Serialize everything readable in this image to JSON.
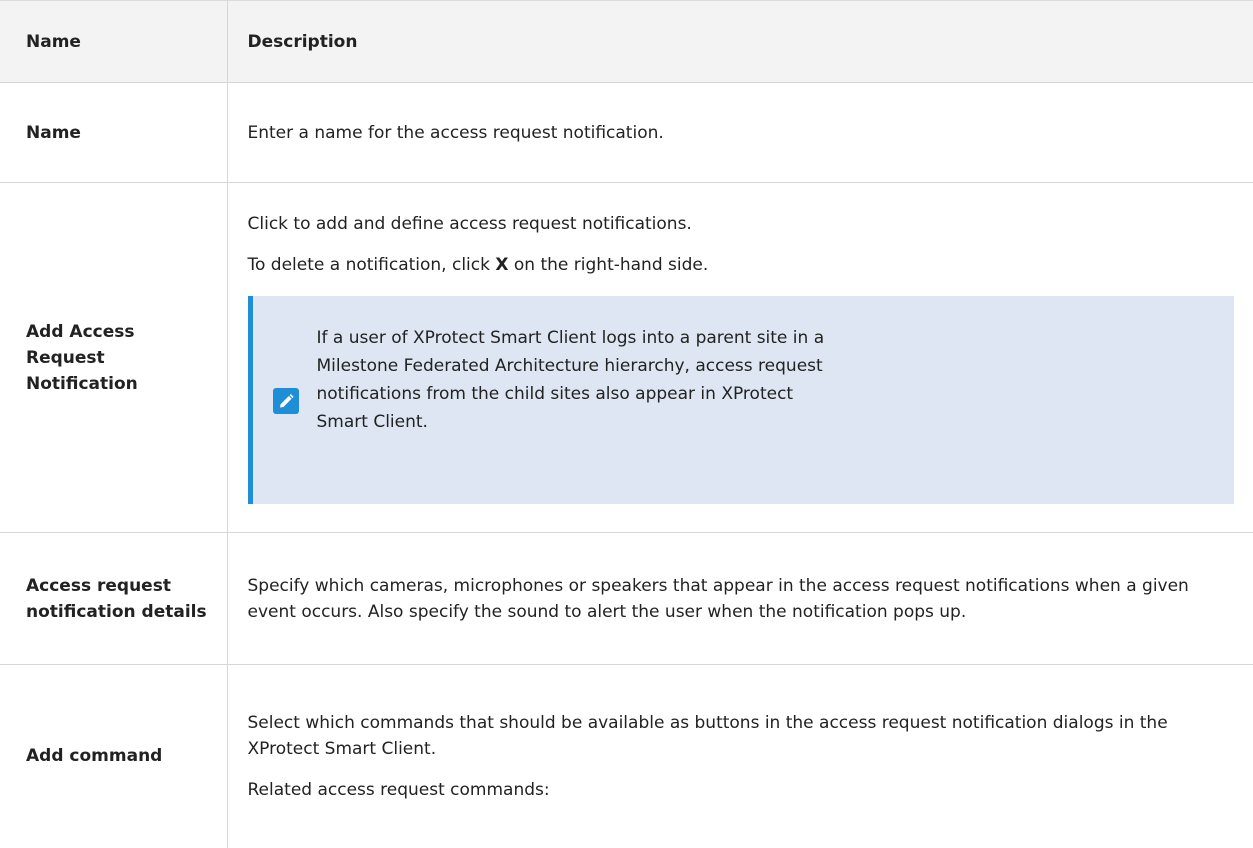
{
  "table": {
    "header": {
      "name": "Name",
      "description": "Description"
    },
    "rows": [
      {
        "name": "Name",
        "description": "Enter a name for the access request notification."
      },
      {
        "name": "Add Access Request Notification",
        "para1": "Click to add and define access request notifications.",
        "para2_before": "To delete a notification, click ",
        "para2_key": "X",
        "para2_after": " on the right-hand side.",
        "note": {
          "icon": "pencil-icon",
          "accent_color": "#1e8fd6",
          "background_color": "#dde6f2",
          "text": "If a user of XProtect Smart Client logs into a parent site in a Milestone Federated Architecture hierarchy, access request notifications from the child sites also appear in XProtect Smart Client."
        }
      },
      {
        "name": "Access request notification details",
        "description": "Specify which cameras, microphones or speakers that appear in the access request notifications when a given event occurs. Also specify the sound to alert the user when the notification pops up."
      },
      {
        "name": "Add command",
        "para1": "Select which commands that should be available as buttons in the access request notification dialogs in the XProtect Smart Client.",
        "para2": "Related access request commands:"
      }
    ]
  }
}
